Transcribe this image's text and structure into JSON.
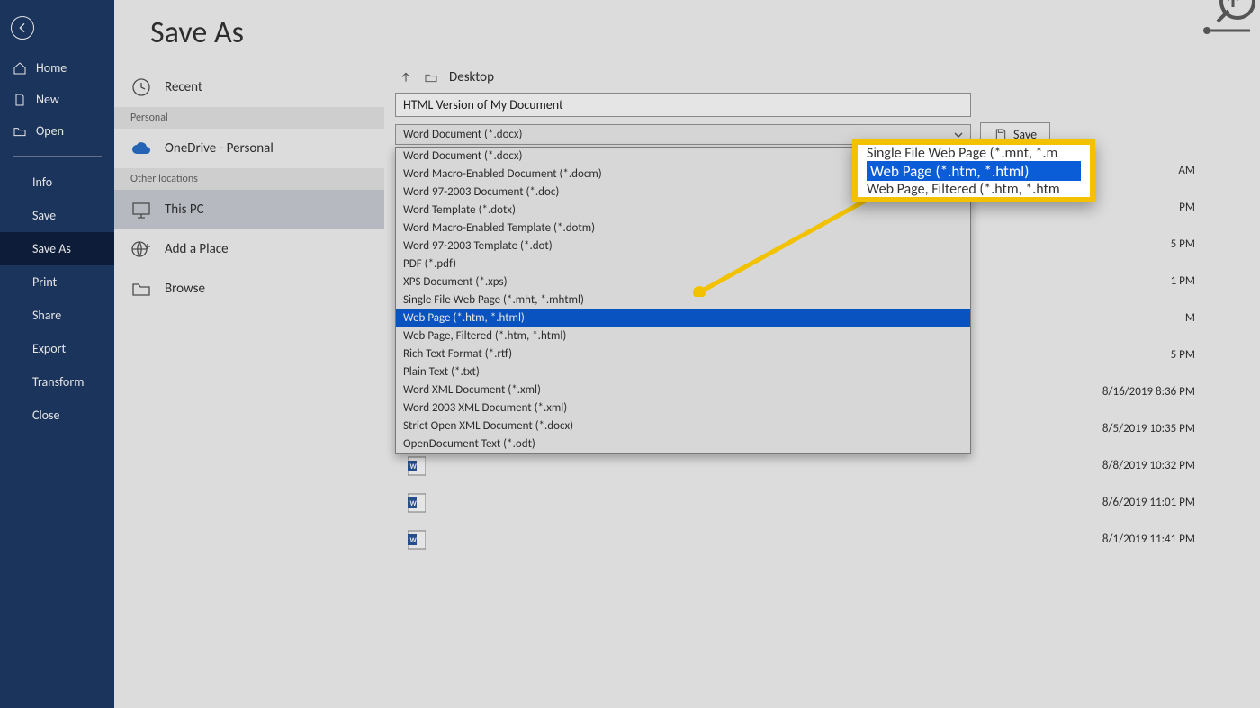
{
  "page_title": "Save As",
  "nav_top": [
    {
      "label": "Home",
      "icon": "home-icon"
    },
    {
      "label": "New",
      "icon": "new-doc-icon"
    },
    {
      "label": "Open",
      "icon": "open-folder-icon"
    }
  ],
  "nav_bottom": [
    {
      "label": "Info"
    },
    {
      "label": "Save"
    },
    {
      "label": "Save As",
      "active": true
    },
    {
      "label": "Print"
    },
    {
      "label": "Share"
    },
    {
      "label": "Export"
    },
    {
      "label": "Transform"
    },
    {
      "label": "Close"
    }
  ],
  "midcol": {
    "recent_label": "Recent",
    "section_personal": "Personal",
    "onedrive_label": "OneDrive - Personal",
    "section_other": "Other locations",
    "this_pc_label": "This PC",
    "add_place_label": "Add a Place",
    "browse_label": "Browse"
  },
  "right": {
    "folder_name": "Desktop",
    "filename": "HTML Version of My Document",
    "type_selected": "Word Document (*.docx)",
    "save_label": "Save",
    "format_options": [
      "Word Document (*.docx)",
      "Word Macro-Enabled Document (*.docm)",
      "Word 97-2003 Document (*.doc)",
      "Word Template (*.dotx)",
      "Word Macro-Enabled Template (*.dotm)",
      "Word 97-2003 Template (*.dot)",
      "PDF (*.pdf)",
      "XPS Document (*.xps)",
      "Single File Web Page (*.mht, *.mhtml)",
      "Web Page (*.htm, *.html)",
      "Web Page, Filtered (*.htm, *.html)",
      "Rich Text Format (*.rtf)",
      "Plain Text (*.txt)",
      "Word XML Document (*.xml)",
      "Word 2003 XML Document (*.xml)",
      "Strict Open XML Document (*.docx)",
      "OpenDocument Text (*.odt)"
    ],
    "highlight_index": 9,
    "file_dates": [
      "AM",
      "PM",
      "5 PM",
      "1 PM",
      "M",
      "5 PM",
      "8/16/2019 8:36 PM",
      "8/5/2019 10:35 PM",
      "8/8/2019 10:32 PM",
      "8/6/2019 11:01 PM",
      "8/1/2019 11:41 PM"
    ]
  },
  "callout": {
    "line_above": "Single File Web Page (*.mnt, *.m",
    "line_sel": "Web Page (*.htm, *.html)",
    "line_below": "Web Page, Filtered (*.htm, *.htm"
  }
}
